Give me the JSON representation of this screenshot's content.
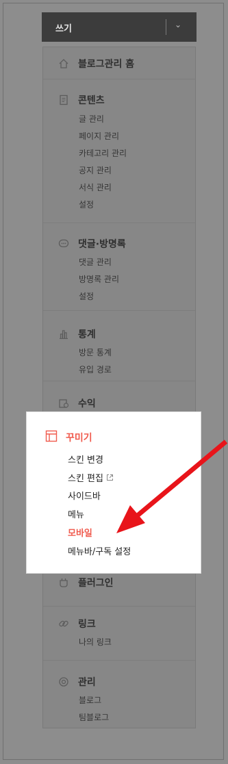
{
  "write": {
    "label": "쓰기"
  },
  "sections": {
    "home": {
      "title": "블로그관리 홈",
      "icon": "home-icon"
    },
    "content": {
      "title": "콘텐츠",
      "icon": "document-icon",
      "items": [
        "글 관리",
        "페이지 관리",
        "카테고리 관리",
        "공지 관리",
        "서식 관리",
        "설정"
      ]
    },
    "comments": {
      "title": "댓글·방명록",
      "icon": "comment-icon",
      "items": [
        "댓글 관리",
        "방명록 관리",
        "설정"
      ]
    },
    "stats": {
      "title": "통계",
      "icon": "bar-chart-icon",
      "items": [
        "방문 통계",
        "유입 경로"
      ]
    },
    "revenue": {
      "title": "수익",
      "icon": "revenue-icon"
    },
    "plugin": {
      "title": "플러그인",
      "icon": "plugin-icon"
    },
    "link": {
      "title": "링크",
      "icon": "link-icon",
      "items": [
        "나의 링크"
      ]
    },
    "manage": {
      "title": "관리",
      "icon": "gear-icon",
      "items": [
        "블로그",
        "팀블로그"
      ]
    }
  },
  "decorate": {
    "title": "꾸미기",
    "icon": "layout-icon",
    "items": [
      "스킨 변경",
      "스킨 편집",
      "사이드바",
      "메뉴",
      "모바일",
      "메뉴바/구독 설정"
    ],
    "active_item": "모바일"
  },
  "colors": {
    "accent": "#f05a4d",
    "arrow": "#e8141a",
    "write_bar": "#3c3c3c"
  }
}
